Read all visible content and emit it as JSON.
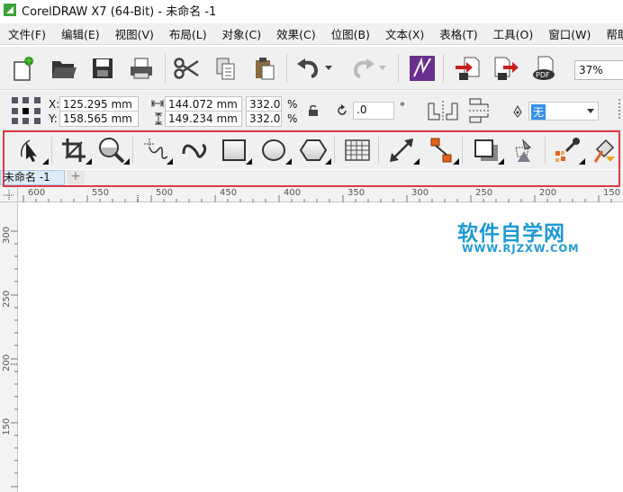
{
  "window": {
    "title": "CorelDRAW X7 (64-Bit) - 未命名 -1"
  },
  "menu": [
    "文件(F)",
    "编辑(E)",
    "视图(V)",
    "布局(L)",
    "对象(C)",
    "效果(C)",
    "位图(B)",
    "文本(X)",
    "表格(T)",
    "工具(O)",
    "窗口(W)",
    "帮助(H)"
  ],
  "standard_toolbar": {
    "zoom": "37%"
  },
  "property_bar": {
    "x_label": "X:",
    "x_value": "125.295 mm",
    "y_label": "Y:",
    "y_value": "158.565 mm",
    "width_value": "144.072 mm",
    "height_value": "149.234 mm",
    "scale_x": "332.0",
    "scale_y": "332.0",
    "percent": "%",
    "rotation": ".0",
    "degree": "°",
    "outline": "无"
  },
  "document_tab": {
    "name": "未命名 -1",
    "add": "+"
  },
  "ruler": {
    "h_ticks": [
      "600",
      "550",
      "500",
      "450",
      "400",
      "350",
      "300",
      "250",
      "200",
      "150"
    ],
    "v_ticks": [
      "300",
      "250",
      "200",
      "150"
    ]
  },
  "watermark": {
    "title": "软件自学网",
    "url": "WWW.RJZXW.COM"
  },
  "colors": {
    "highlight": "#e03a43",
    "watermark": "#1d9ad6",
    "tab": "#dcebf8"
  }
}
